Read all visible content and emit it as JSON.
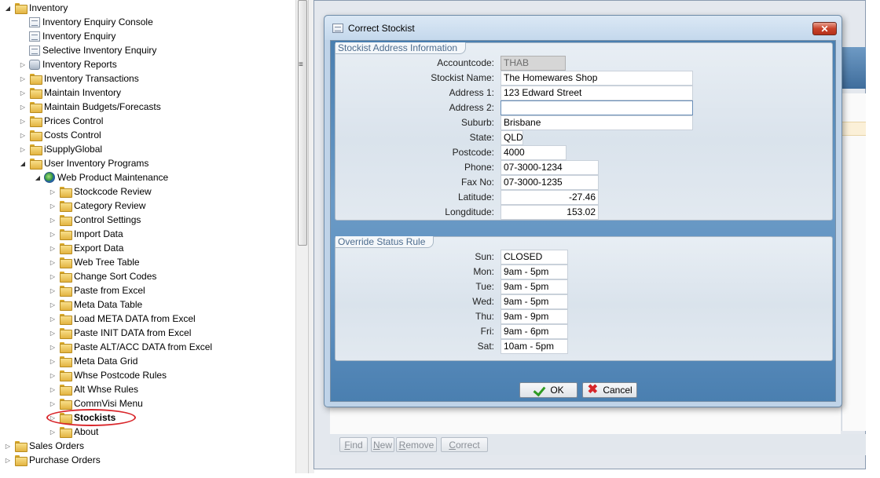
{
  "tree": {
    "items": [
      {
        "label": "Inventory",
        "icon": "folder-icon",
        "level": 0,
        "expander": "open",
        "bold": false
      },
      {
        "label": "Inventory Enquiry Console",
        "icon": "document-icon",
        "level": 1,
        "expander": "none",
        "bold": false
      },
      {
        "label": "Inventory Enquiry",
        "icon": "document-icon",
        "level": 1,
        "expander": "none",
        "bold": false
      },
      {
        "label": "Selective Inventory Enquiry",
        "icon": "document-icon",
        "level": 1,
        "expander": "none",
        "bold": false
      },
      {
        "label": "Inventory Reports",
        "icon": "report-icon",
        "level": 1,
        "expander": "closed",
        "bold": false
      },
      {
        "label": "Inventory Transactions",
        "icon": "folder-icon",
        "level": 1,
        "expander": "closed",
        "bold": false
      },
      {
        "label": "Maintain Inventory",
        "icon": "folder-icon",
        "level": 1,
        "expander": "closed",
        "bold": false
      },
      {
        "label": "Maintain Budgets/Forecasts",
        "icon": "folder-icon",
        "level": 1,
        "expander": "closed",
        "bold": false
      },
      {
        "label": "Prices Control",
        "icon": "folder-icon",
        "level": 1,
        "expander": "closed",
        "bold": false
      },
      {
        "label": "Costs Control",
        "icon": "folder-icon",
        "level": 1,
        "expander": "closed",
        "bold": false
      },
      {
        "label": "iSupplyGlobal",
        "icon": "folder-icon",
        "level": 1,
        "expander": "closed",
        "bold": false
      },
      {
        "label": "User Inventory Programs",
        "icon": "folder-icon",
        "level": 1,
        "expander": "open",
        "bold": false
      },
      {
        "label": "Web Product Maintenance",
        "icon": "globe-icon",
        "level": 2,
        "expander": "open",
        "bold": false
      },
      {
        "label": "Stockcode Review",
        "icon": "folder-icon",
        "level": 3,
        "expander": "closed",
        "bold": false
      },
      {
        "label": "Category Review",
        "icon": "folder-icon",
        "level": 3,
        "expander": "closed",
        "bold": false
      },
      {
        "label": "Control Settings",
        "icon": "folder-icon",
        "level": 3,
        "expander": "closed",
        "bold": false
      },
      {
        "label": "Import Data",
        "icon": "folder-icon",
        "level": 3,
        "expander": "closed",
        "bold": false
      },
      {
        "label": "Export Data",
        "icon": "folder-icon",
        "level": 3,
        "expander": "closed",
        "bold": false
      },
      {
        "label": "Web Tree Table",
        "icon": "folder-icon",
        "level": 3,
        "expander": "closed",
        "bold": false
      },
      {
        "label": "Change Sort Codes",
        "icon": "folder-icon",
        "level": 3,
        "expander": "closed",
        "bold": false
      },
      {
        "label": "Paste from Excel",
        "icon": "folder-icon",
        "level": 3,
        "expander": "closed",
        "bold": false
      },
      {
        "label": "Meta Data Table",
        "icon": "folder-icon",
        "level": 3,
        "expander": "closed",
        "bold": false
      },
      {
        "label": "Load META DATA from Excel",
        "icon": "folder-icon",
        "level": 3,
        "expander": "closed",
        "bold": false
      },
      {
        "label": "Paste INIT DATA from Excel",
        "icon": "folder-icon",
        "level": 3,
        "expander": "closed",
        "bold": false
      },
      {
        "label": "Paste ALT/ACC DATA from Excel",
        "icon": "folder-icon",
        "level": 3,
        "expander": "closed",
        "bold": false
      },
      {
        "label": "Meta Data Grid",
        "icon": "folder-icon",
        "level": 3,
        "expander": "closed",
        "bold": false
      },
      {
        "label": "Whse Postcode Rules",
        "icon": "folder-icon",
        "level": 3,
        "expander": "closed",
        "bold": false
      },
      {
        "label": "Alt Whse Rules",
        "icon": "folder-icon",
        "level": 3,
        "expander": "closed",
        "bold": false
      },
      {
        "label": "CommVisi Menu",
        "icon": "folder-icon",
        "level": 3,
        "expander": "closed",
        "bold": false
      },
      {
        "label": "Stockists",
        "icon": "folder-icon",
        "level": 3,
        "expander": "closed",
        "bold": true
      },
      {
        "label": "About",
        "icon": "folder-icon",
        "level": 3,
        "expander": "closed",
        "bold": false
      },
      {
        "label": "Sales Orders",
        "icon": "folder-icon",
        "level": 0,
        "expander": "closed",
        "bold": false
      },
      {
        "label": "Purchase Orders",
        "icon": "folder-icon",
        "level": 0,
        "expander": "closed",
        "bold": false
      }
    ]
  },
  "background_window": {
    "buttons": [
      {
        "label": "Find",
        "underline": "F"
      },
      {
        "label": "New",
        "underline": "N"
      },
      {
        "label": "Remove",
        "underline": "R"
      },
      {
        "label": "Correct",
        "underline": "C"
      }
    ]
  },
  "dialog": {
    "title": "Correct Stockist",
    "close_label": "✕",
    "address_group": {
      "title": "Stockist Address Information",
      "fields": [
        {
          "label": "Accountcode:",
          "value": "THAB",
          "state": "disabled"
        },
        {
          "label": "Stockist Name:",
          "value": "The Homewares Shop",
          "state": "normal"
        },
        {
          "label": "Address 1:",
          "value": "123 Edward Street",
          "state": "normal"
        },
        {
          "label": "Address 2:",
          "value": "",
          "state": "focused"
        },
        {
          "label": "Suburb:",
          "value": "Brisbane",
          "state": "normal"
        },
        {
          "label": "State:",
          "value": "QLD",
          "state": "normal"
        },
        {
          "label": "Postcode:",
          "value": "4000",
          "state": "normal"
        },
        {
          "label": "Phone:",
          "value": "07-3000-1234",
          "state": "normal"
        },
        {
          "label": "Fax No:",
          "value": "07-3000-1235",
          "state": "normal"
        },
        {
          "label": "Latitude:",
          "value": "-27.46",
          "state": "normal"
        },
        {
          "label": "Longditude:",
          "value": "153.02",
          "state": "normal"
        }
      ]
    },
    "status_group": {
      "title": "Override Status Rule",
      "fields": [
        {
          "label": "Sun:",
          "value": "CLOSED"
        },
        {
          "label": "Mon:",
          "value": "9am - 5pm"
        },
        {
          "label": "Tue:",
          "value": "9am - 5pm"
        },
        {
          "label": "Wed:",
          "value": "9am - 5pm"
        },
        {
          "label": "Thu:",
          "value": "9am - 9pm"
        },
        {
          "label": "Fri:",
          "value": "9am - 6pm"
        },
        {
          "label": "Sat:",
          "value": "10am - 5pm"
        }
      ]
    },
    "ok_label": "OK",
    "cancel_label": "Cancel"
  }
}
